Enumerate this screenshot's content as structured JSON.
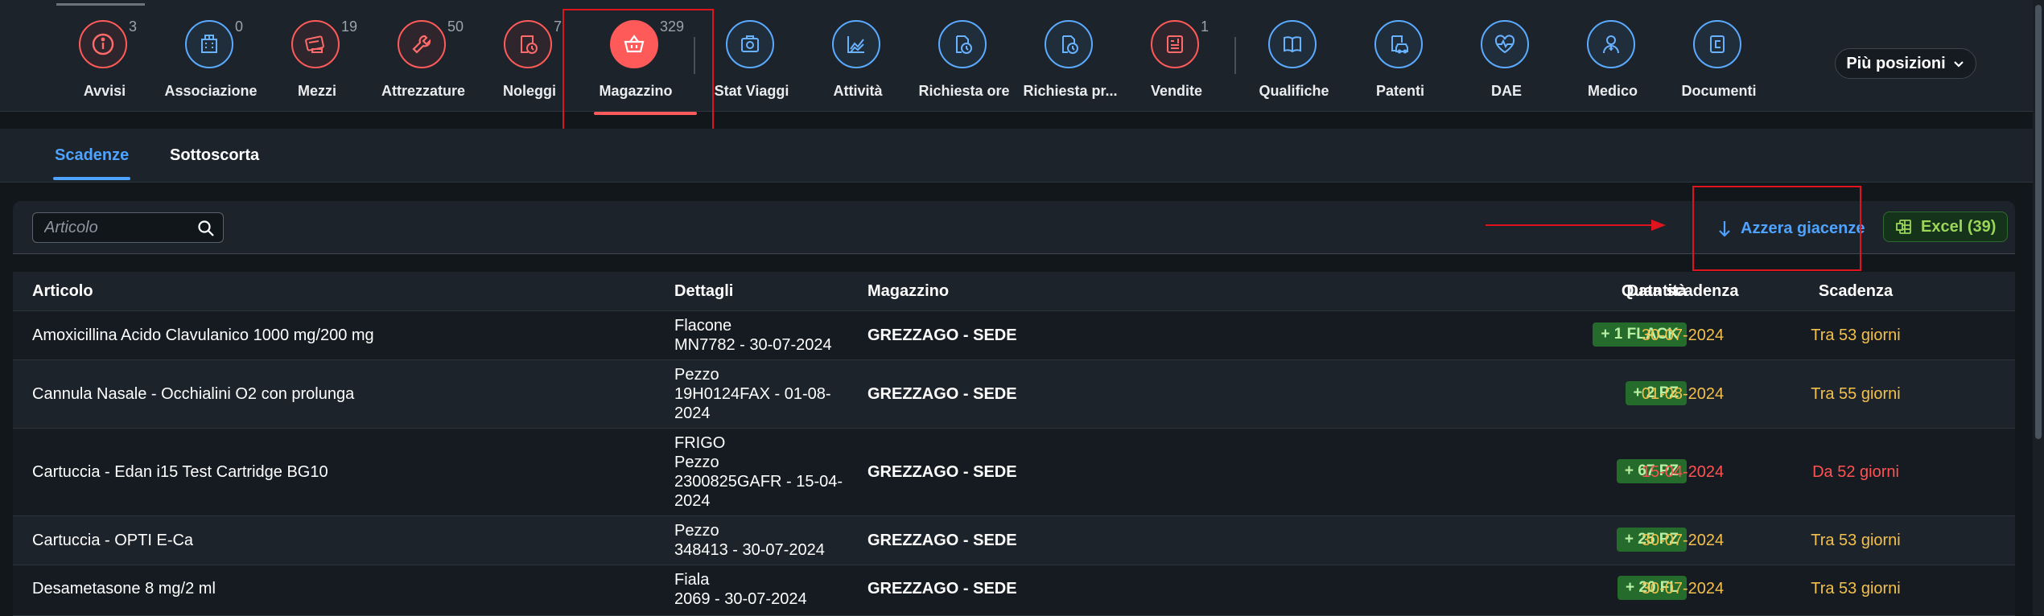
{
  "nav": [
    {
      "label": "Avvisi",
      "icon": "info-icon",
      "badge": "3",
      "color": "red"
    },
    {
      "label": "Associazione",
      "icon": "building-icon",
      "badge": "0",
      "color": "blue"
    },
    {
      "label": "Mezzi",
      "icon": "vehicle-card-icon",
      "badge": "19",
      "color": "red"
    },
    {
      "label": "Attrezzature",
      "icon": "wrench-icon",
      "badge": "50",
      "color": "red"
    },
    {
      "label": "Noleggi",
      "icon": "rental-clock-icon",
      "badge": "7",
      "color": "red"
    },
    {
      "label": "Magazzino",
      "icon": "basket-icon",
      "badge": "329",
      "color": "red",
      "active": true
    },
    {
      "label": "Stat Viaggi",
      "icon": "trip-stats-icon",
      "badge": "",
      "color": "blue"
    },
    {
      "label": "Attività",
      "icon": "area-chart-icon",
      "badge": "",
      "color": "blue"
    },
    {
      "label": "Richiesta ore",
      "icon": "document-clock-icon",
      "badge": "",
      "color": "blue"
    },
    {
      "label": "Richiesta pr...",
      "icon": "document-clock-icon",
      "badge": "",
      "color": "blue"
    },
    {
      "label": "Vendite",
      "icon": "invoice-icon",
      "badge": "1",
      "color": "red"
    },
    {
      "label": "Qualifiche",
      "icon": "open-book-icon",
      "badge": "",
      "color": "blue"
    },
    {
      "label": "Patenti",
      "icon": "license-car-icon",
      "badge": "",
      "color": "blue"
    },
    {
      "label": "DAE",
      "icon": "heart-pulse-icon",
      "badge": "",
      "color": "blue"
    },
    {
      "label": "Medico",
      "icon": "doctor-icon",
      "badge": "",
      "color": "blue"
    },
    {
      "label": "Documenti",
      "icon": "documents-icon",
      "badge": "",
      "color": "blue"
    }
  ],
  "more_label": "Più posizioni",
  "tabs": [
    {
      "label": "Scadenze",
      "selected": true
    },
    {
      "label": "Sottoscorta",
      "selected": false
    }
  ],
  "search": {
    "placeholder": "Articolo",
    "value": ""
  },
  "actions": {
    "azzera": "Azzera giacenze",
    "excel": "Excel (39)"
  },
  "columns": {
    "articolo": "Articolo",
    "dettagli": "Dettagli",
    "magazzino": "Magazzino",
    "quantita": "Quantità",
    "data": "Data scadenza",
    "scadenza": "Scadenza"
  },
  "rows": [
    {
      "articolo": "Amoxicillina Acido Clavulanico 1000 mg/200 mg",
      "dettagli": [
        "Flacone",
        "MN7782 - 30-07-2024"
      ],
      "magazzino": "GREZZAGO - SEDE",
      "quantita": "+ 1 FLACK",
      "data": "30-07-2024",
      "scadenza": "Tra 53 giorni",
      "status": "warn"
    },
    {
      "articolo": "Cannula Nasale - Occhialini O2 con prolunga",
      "dettagli": [
        "Pezzo",
        "19H0124FAX - 01-08-",
        "2024"
      ],
      "magazzino": "GREZZAGO - SEDE",
      "quantita": "+ 2 PZ",
      "data": "01-08-2024",
      "scadenza": "Tra 55 giorni",
      "status": "warn"
    },
    {
      "articolo": "Cartuccia - Edan i15 Test Cartridge BG10",
      "dettagli": [
        "FRIGO",
        "Pezzo",
        "2300825GAFR - 15-04-",
        "2024"
      ],
      "magazzino": "GREZZAGO - SEDE",
      "quantita": "+ 67 PZ",
      "data": "15-04-2024",
      "scadenza": "Da 52 giorni",
      "status": "err"
    },
    {
      "articolo": "Cartuccia - OPTI E-Ca",
      "dettagli": [
        "Pezzo",
        "348413 - 30-07-2024"
      ],
      "magazzino": "GREZZAGO - SEDE",
      "quantita": "+ 25 PZ",
      "data": "30-07-2024",
      "scadenza": "Tra 53 giorni",
      "status": "warn"
    },
    {
      "articolo": "Desametasone 8 mg/2 ml",
      "dettagli": [
        "Fiala",
        "2069 - 30-07-2024"
      ],
      "magazzino": "GREZZAGO - SEDE",
      "quantita": "+ 20 FL",
      "data": "30-07-2024",
      "scadenza": "Tra 53 giorni",
      "status": "warn"
    }
  ],
  "colors": {
    "accent_red": "#ff5a5a",
    "accent_blue": "#4da3ff",
    "warning": "#f3c04c",
    "error": "#ff5252",
    "qty_badge": "#246b2c"
  }
}
